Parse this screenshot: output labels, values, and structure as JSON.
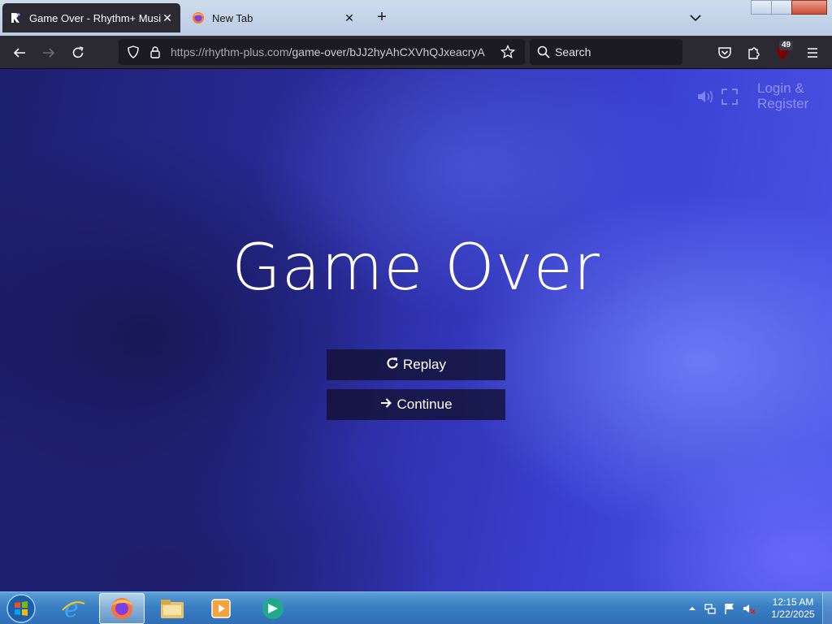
{
  "browser": {
    "tabs": [
      {
        "title": "Game Over - Rhythm+ Music G",
        "active": true
      },
      {
        "title": "New Tab",
        "active": false
      }
    ],
    "url_host": "https://rhythm-plus.com",
    "url_path": "/game-over/bJJ2hyAhCXVhQJxeacryA",
    "search_label": "Search",
    "extension_badge": "49"
  },
  "page": {
    "login_label": "Login & Register",
    "title": "Game Over",
    "replay_label": "Replay",
    "continue_label": "Continue"
  },
  "taskbar": {
    "apps": [
      "internet-explorer",
      "firefox",
      "file-explorer",
      "media-player",
      "app-green"
    ],
    "active_app": "firefox",
    "time": "12:15 AM",
    "date": "1/22/2025"
  },
  "colors": {
    "accent": "#2a2c9e",
    "browser_chrome": "#2b2a33",
    "taskbar": "#3a7fc4"
  }
}
